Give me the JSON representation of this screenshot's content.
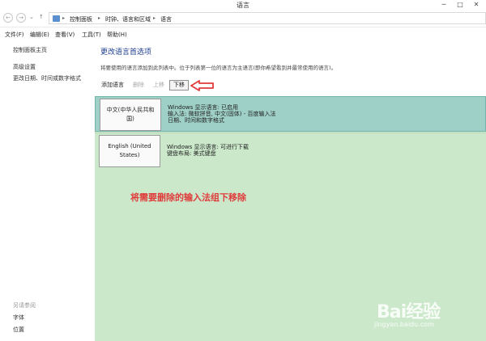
{
  "window": {
    "title": "语言",
    "minimize": "─",
    "maximize": "□",
    "close": "✕"
  },
  "address": {
    "nav_back": "←",
    "nav_forward": "→",
    "nav_dropdown": "⌄",
    "nav_up": "↑",
    "crumbs": [
      "控制面板",
      "时钟、语言和区域",
      "语言"
    ],
    "separator": "▸"
  },
  "menu": [
    "文件(F)",
    "编辑(E)",
    "查看(V)",
    "工具(T)",
    "帮助(H)"
  ],
  "sidebar": {
    "links": [
      "控制面板主页",
      "高级设置",
      "更改日期、时间或数字格式"
    ],
    "see_also": "另请参阅",
    "bottom_links": [
      "字体",
      "位置"
    ]
  },
  "main": {
    "heading": "更改语言首选项",
    "description": "将要使用的语言添加到此列表中。位于列表第一位的语言为主语言(即你希望看到并最常使用的语言)。",
    "toolbar": {
      "add": "添加语言",
      "delete": "删除",
      "up": "上移",
      "down": "下移"
    },
    "languages": [
      {
        "name": "中文(中华人民共和国)",
        "line1": "Windows 显示语言: 已启用",
        "line2": "输入法: 微软拼音, 中文(固体) - 百度输入法",
        "line3": "日期、时间和数字格式"
      },
      {
        "name": "English (United States)",
        "line1": "Windows 显示语言: 可进行下载",
        "line2": "键盘布局: 美式键盘",
        "line3": ""
      }
    ]
  },
  "annotation": "将需要删除的输入法组下移除",
  "watermark": {
    "logo": "Bai经验",
    "url": "jingyan.baidu.com"
  },
  "colors": {
    "list_background": "#cbe8cb",
    "selected_row": "#9fd0c8",
    "annotation": "#e03b3b",
    "heading": "#1e3f8f"
  }
}
